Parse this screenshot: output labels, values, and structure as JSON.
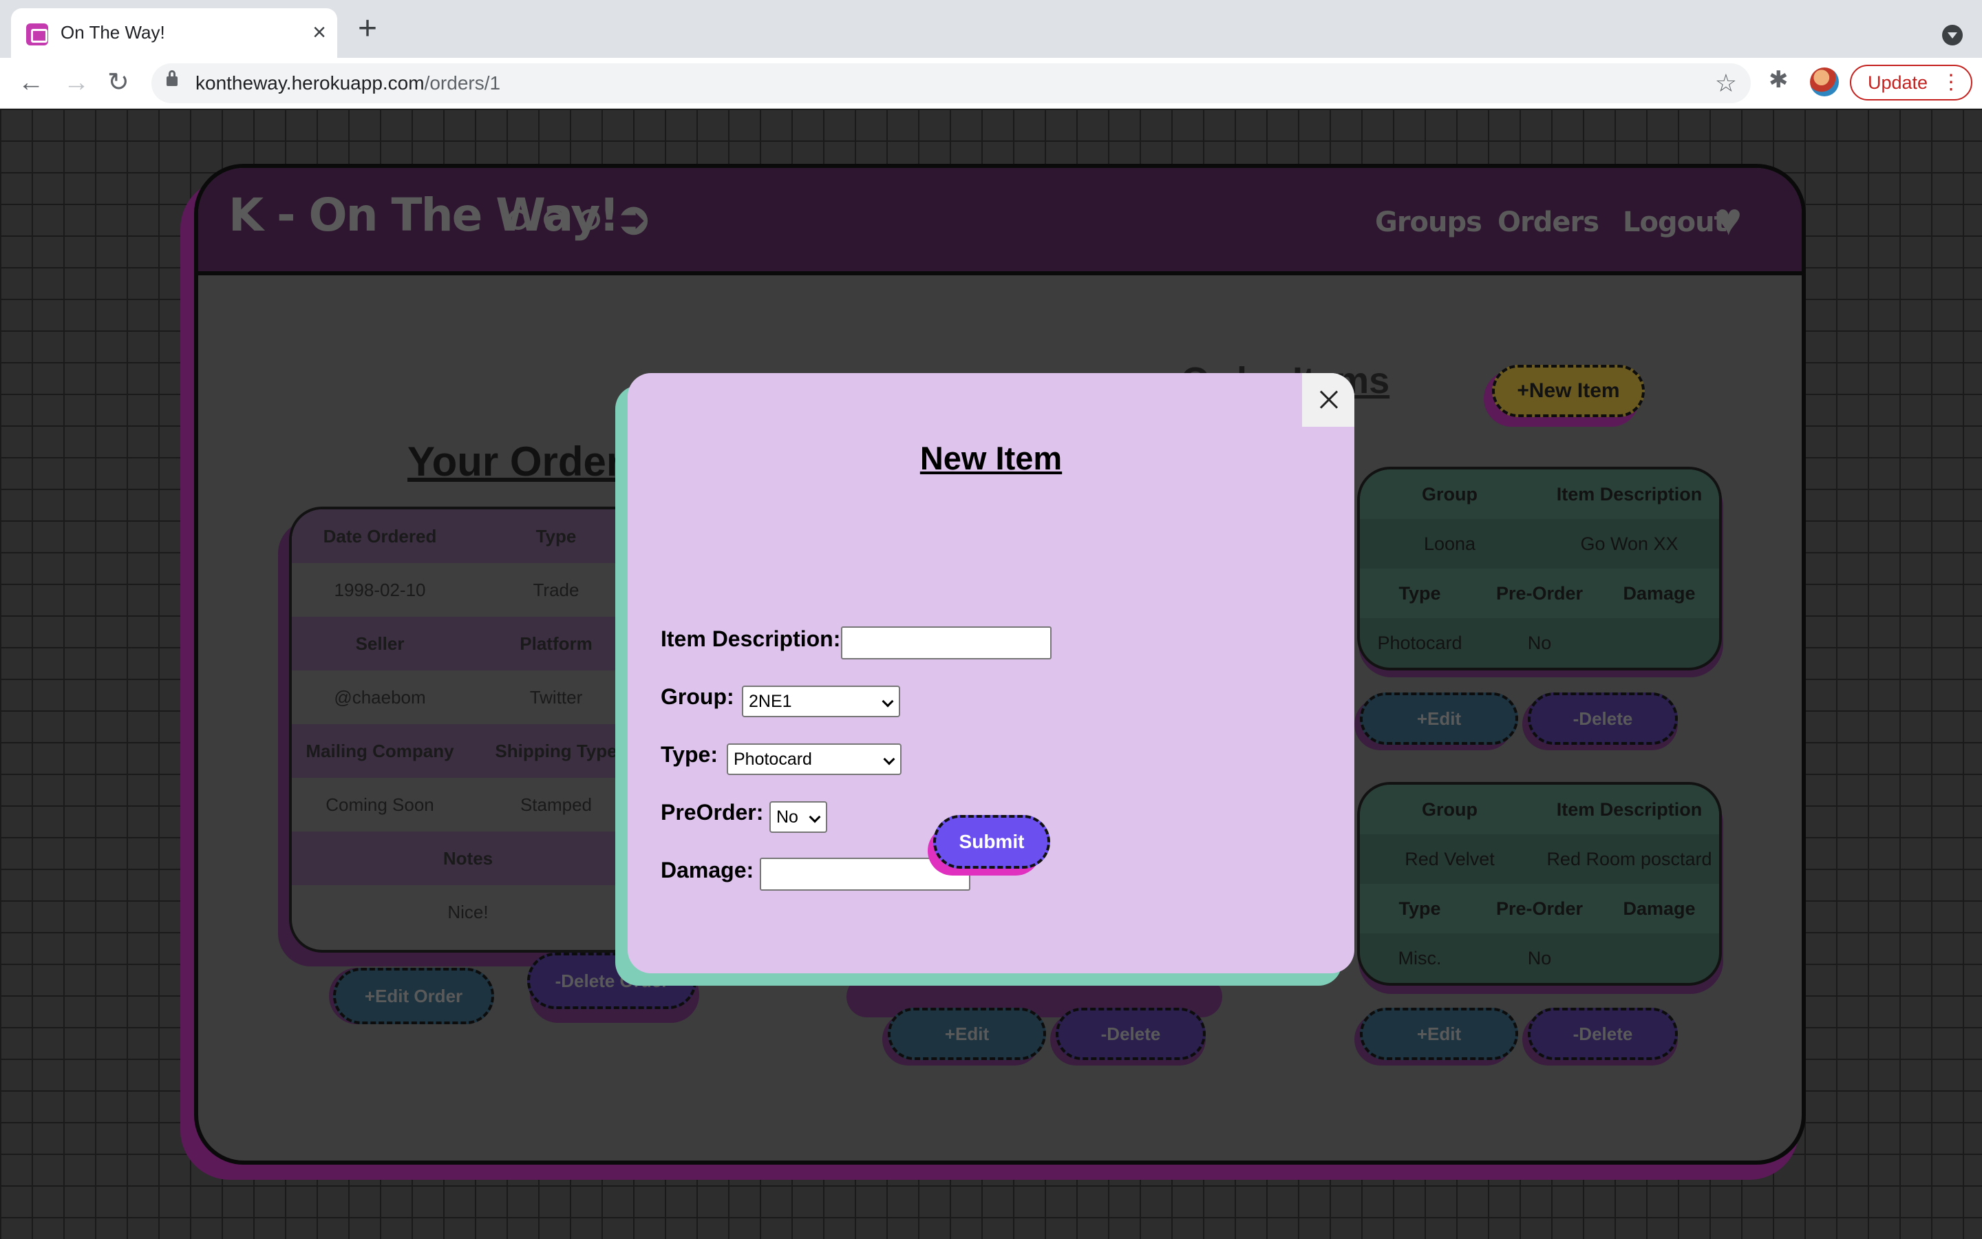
{
  "browser": {
    "tab_title": "On The Way!",
    "tab_close": "×",
    "new_tab": "+",
    "url_domain": "kontheway.herokuapp.com",
    "url_path": "/orders/1",
    "update_label": "Update",
    "nav_back": "←",
    "nav_forward": "→",
    "nav_reload": "↻",
    "star": "☆",
    "extensions": "✱"
  },
  "site": {
    "brand": "K - On The Way!",
    "arrow": "➲",
    "nav": [
      "Groups",
      "Orders",
      "Logout"
    ],
    "heart": "♥"
  },
  "order": {
    "heading": "Your Order",
    "rows": [
      {
        "type": "hdr",
        "cells": [
          "Date Ordered",
          "Type"
        ]
      },
      {
        "type": "val",
        "cells": [
          "1998-02-10",
          "Trade"
        ]
      },
      {
        "type": "hdr",
        "cells": [
          "Seller",
          "Platform"
        ]
      },
      {
        "type": "val",
        "cells": [
          "@chaebom",
          "Twitter"
        ]
      },
      {
        "type": "hdr",
        "cells": [
          "Mailing Company",
          "Shipping Type"
        ]
      },
      {
        "type": "val",
        "cells": [
          "Coming Soon",
          "Stamped"
        ]
      },
      {
        "type": "hdr",
        "cells": [
          "Notes"
        ]
      },
      {
        "type": "val",
        "cells": [
          "Nice!"
        ]
      }
    ],
    "edit_button": "+Edit Order",
    "delete_button": "-Delete Order"
  },
  "items": {
    "heading": "Order Items",
    "new_item_button": "+New Item",
    "cards": [
      {
        "header1": [
          "Group",
          "Item Description"
        ],
        "values1": [
          "Loona",
          "Go Won XX"
        ],
        "header2": [
          "Type",
          "Pre-Order",
          "Damage"
        ],
        "values2": [
          "Photocard",
          "No",
          ""
        ],
        "edit": "+Edit",
        "delete": "-Delete"
      },
      {
        "header1": [
          "Group",
          "Item Description"
        ],
        "values1": [
          "Red Velvet",
          "Red Room posctard"
        ],
        "header2": [
          "Type",
          "Pre-Order",
          "Damage"
        ],
        "values2": [
          "Misc.",
          "No",
          ""
        ],
        "edit": "+Edit",
        "delete": "-Delete"
      }
    ],
    "hidden_card_buttons": {
      "edit": "+Edit",
      "delete": "-Delete"
    }
  },
  "modal": {
    "title": "New Item",
    "close_icon": "close-icon",
    "labels": {
      "description": "Item Description:",
      "group": "Group:",
      "type": "Type:",
      "preorder": "PreOrder:",
      "damage": "Damage:"
    },
    "values": {
      "description": "",
      "group": "2NE1",
      "type": "Photocard",
      "preorder": "No",
      "damage": ""
    },
    "submit": "Submit"
  },
  "colors": {
    "modal_bg": "#dec4ec",
    "modal_shadow": "#7fcfb8",
    "submit_bg": "#6b50ef",
    "submit_shadow": "#e030c0",
    "card_frame": "#5c1a58"
  }
}
